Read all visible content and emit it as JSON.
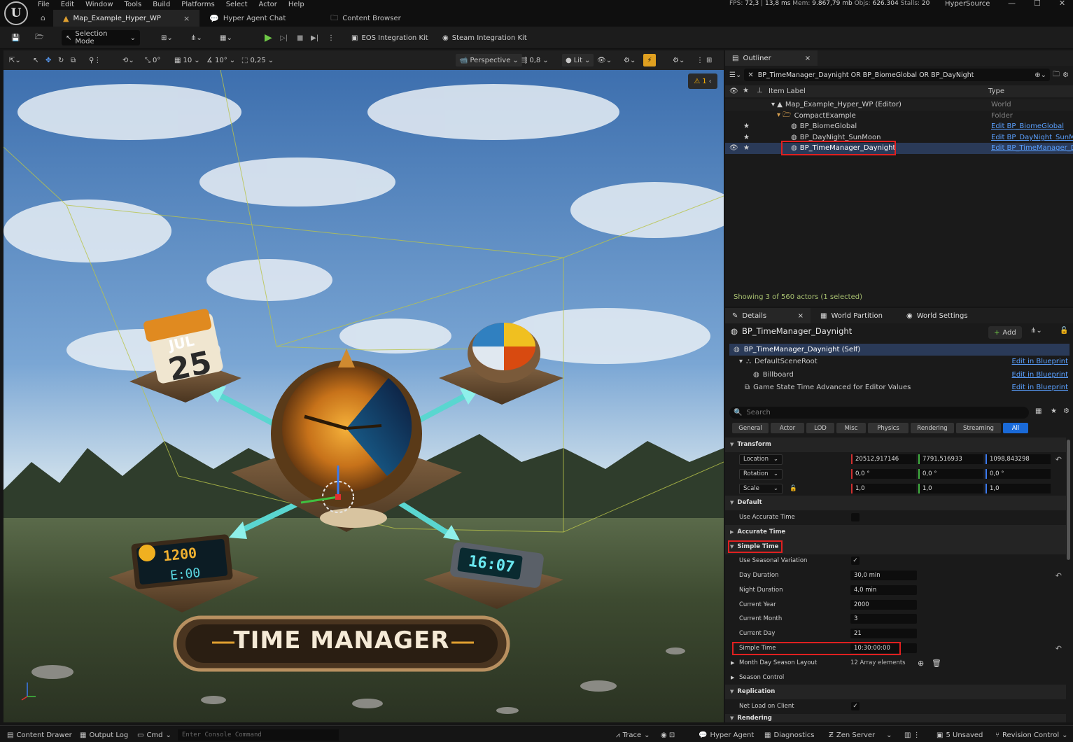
{
  "menu": [
    "File",
    "Edit",
    "Window",
    "Tools",
    "Build",
    "Platforms",
    "Select",
    "Actor",
    "Help"
  ],
  "stats": {
    "fps_label": "FPS:",
    "fps": "72,3",
    "ms": "13,8 ms",
    "mem_label": "Mem:",
    "mem": "9.867,79 mb",
    "objs_label": "Objs:",
    "objs": "626.304",
    "stalls_label": "Stalls:",
    "stalls": "20"
  },
  "project_name": "HyperSource",
  "tabs": [
    "Map_Example_Hyper_WP",
    "Hyper Agent Chat",
    "Content Browser"
  ],
  "toolbar": {
    "selection_mode": "Selection Mode",
    "eos": "EOS Integration Kit",
    "steam": "Steam Integration Kit"
  },
  "viewport_bar": {
    "rot_snap": "0°",
    "grid_snap": "10",
    "angle_snap": "10°",
    "scale_snap": "0,25",
    "perspective": "Perspective",
    "fov": "0,8",
    "lit": "Lit",
    "warning_count": "1"
  },
  "scene": {
    "title": "TIME MANAGER",
    "calendar_month": "JUL",
    "calendar_day": "25",
    "digital_time_top": "1200",
    "digital_time_bottom": "E:00",
    "clock2": "16:07"
  },
  "outliner": {
    "tab": "Outliner",
    "search": "BP_TimeManager_Daynight OR BP_BiomeGlobal OR BP_DayNight",
    "col_label": "Item Label",
    "col_type": "Type",
    "rows": [
      {
        "label": "Map_Example_Hyper_WP (Editor)",
        "type": "World"
      },
      {
        "label": "CompactExample",
        "type": "Folder"
      },
      {
        "label": "BP_BiomeGlobal",
        "type": "Edit BP_BiomeGlobal"
      },
      {
        "label": "BP_DayNight_SunMoon",
        "type": "Edit BP_DayNight_SunMoo"
      },
      {
        "label": "BP_TimeManager_Daynight",
        "type": "Edit BP_TimeManager_Day"
      }
    ],
    "status": "Showing 3 of 560 actors (1 selected)"
  },
  "details": {
    "tabs": [
      "Details",
      "World Partition",
      "World Settings"
    ],
    "object": "BP_TimeManager_Daynight",
    "add": "Add",
    "components": [
      {
        "label": "BP_TimeManager_Daynight (Self)",
        "link": ""
      },
      {
        "label": "DefaultSceneRoot",
        "link": "Edit in Blueprint"
      },
      {
        "label": "Billboard",
        "link": "Edit in Blueprint"
      },
      {
        "label": "Game State Time Advanced for Editor Values",
        "link": "Edit in Blueprint"
      }
    ],
    "search_placeholder": "Search",
    "filters": [
      "General",
      "Actor",
      "LOD",
      "Misc",
      "Physics",
      "Rendering",
      "Streaming",
      "All"
    ],
    "transform": {
      "header": "Transform",
      "location": "Location",
      "rotation": "Rotation",
      "scale": "Scale",
      "loc": [
        "20512,917146",
        "7791,516933",
        "1098,843298"
      ],
      "rot": [
        "0,0 °",
        "0,0 °",
        "0,0 °"
      ],
      "scl": [
        "1,0",
        "1,0",
        "1,0"
      ]
    },
    "cat_default": "Default",
    "use_accurate_time": "Use Accurate Time",
    "cat_accurate": "Accurate Time",
    "cat_simple": "Simple Time",
    "props": [
      {
        "label": "Use Seasonal Variation",
        "value": ""
      },
      {
        "label": "Day Duration",
        "value": "30,0 min"
      },
      {
        "label": "Night Duration",
        "value": "4,0 min"
      },
      {
        "label": "Current Year",
        "value": "2000"
      },
      {
        "label": "Current Month",
        "value": "3"
      },
      {
        "label": "Current Day",
        "value": "21"
      },
      {
        "label": "Simple Time",
        "value": "10:30:00:00"
      }
    ],
    "month_layout": "Month Day Season Layout",
    "month_layout_value": "12 Array elements",
    "cat_season": "Season Control",
    "cat_replication": "Replication",
    "net_load": "Net Load on Client",
    "cat_rendering": "Rendering"
  },
  "status": {
    "content_drawer": "Content Drawer",
    "output_log": "Output Log",
    "cmd": "Cmd",
    "console_placeholder": "Enter Console Command",
    "trace": "Trace",
    "hyper_agent": "Hyper Agent",
    "diagnostics": "Diagnostics",
    "zen": "Zen Server",
    "unsaved": "5 Unsaved",
    "revision": "Revision Control"
  }
}
